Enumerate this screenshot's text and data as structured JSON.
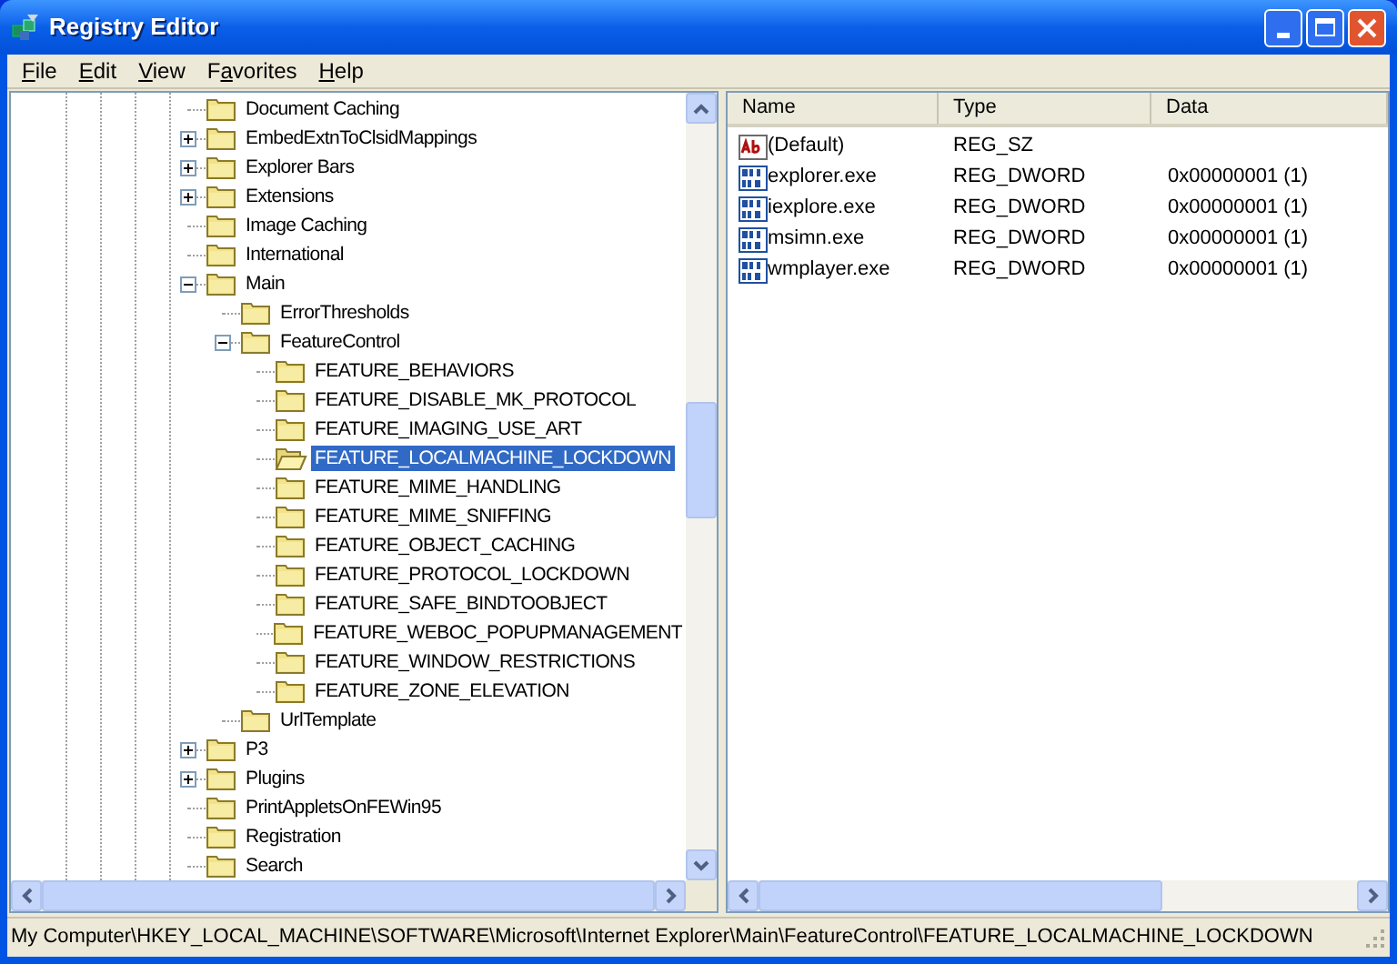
{
  "window": {
    "title": "Registry Editor"
  },
  "menu": [
    {
      "accel": "F",
      "after": "ile"
    },
    {
      "accel": "E",
      "after": "dit"
    },
    {
      "accel": "V",
      "after": "iew"
    },
    {
      "before": "F",
      "accel": "a",
      "after": "vorites"
    },
    {
      "accel": "H",
      "after": "elp"
    }
  ],
  "tree": [
    {
      "label": "Document Caching",
      "selected": false
    },
    {
      "label": "EmbedExtnToClsidMappings",
      "expanded": false,
      "selected": false
    },
    {
      "label": "Explorer Bars",
      "expanded": false,
      "selected": false
    },
    {
      "label": "Extensions",
      "expanded": false,
      "selected": false
    },
    {
      "label": "Image Caching",
      "selected": false
    },
    {
      "label": "International",
      "selected": false
    },
    {
      "label": "Main",
      "expanded": true,
      "selected": false,
      "children": [
        {
          "label": "ErrorThresholds",
          "selected": false
        },
        {
          "label": "FeatureControl",
          "expanded": true,
          "selected": false,
          "children": [
            {
              "label": "FEATURE_BEHAVIORS",
              "selected": false
            },
            {
              "label": "FEATURE_DISABLE_MK_PROTOCOL",
              "selected": false
            },
            {
              "label": "FEATURE_IMAGING_USE_ART",
              "selected": false
            },
            {
              "label": "FEATURE_LOCALMACHINE_LOCKDOWN",
              "selected": true
            },
            {
              "label": "FEATURE_MIME_HANDLING",
              "selected": false
            },
            {
              "label": "FEATURE_MIME_SNIFFING",
              "selected": false
            },
            {
              "label": "FEATURE_OBJECT_CACHING",
              "selected": false
            },
            {
              "label": "FEATURE_PROTOCOL_LOCKDOWN",
              "selected": false
            },
            {
              "label": "FEATURE_SAFE_BINDTOOBJECT",
              "selected": false
            },
            {
              "label": "FEATURE_WEBOC_POPUPMANAGEMENT",
              "selected": false
            },
            {
              "label": "FEATURE_WINDOW_RESTRICTIONS",
              "selected": false
            },
            {
              "label": "FEATURE_ZONE_ELEVATION",
              "selected": false
            }
          ]
        },
        {
          "label": "UrlTemplate",
          "selected": false
        }
      ]
    },
    {
      "label": "P3",
      "expanded": false,
      "selected": false
    },
    {
      "label": "Plugins",
      "expanded": false,
      "selected": false
    },
    {
      "label": "PrintAppletsOnFEWin95",
      "selected": false
    },
    {
      "label": "Registration",
      "selected": false
    },
    {
      "label": "Search",
      "selected": false
    }
  ],
  "values": {
    "columns": [
      "Name",
      "Type",
      "Data"
    ],
    "rows": [
      {
        "kind": "string",
        "name": "(Default)",
        "type": "REG_SZ"
      },
      {
        "kind": "dword",
        "name": "explorer.exe",
        "type": "REG_DWORD",
        "data": "0x00000001 (1)"
      },
      {
        "kind": "dword",
        "name": "iexplore.exe",
        "type": "REG_DWORD",
        "data": "0x00000001 (1)"
      },
      {
        "kind": "dword",
        "name": "msimn.exe",
        "type": "REG_DWORD",
        "data": "0x00000001 (1)"
      },
      {
        "kind": "dword",
        "name": "wmplayer.exe",
        "type": "REG_DWORD",
        "data": "0x00000001 (1)"
      }
    ]
  },
  "status_bar": "My Computer\\HKEY_LOCAL_MACHINE\\SOFTWARE\\Microsoft\\Internet Explorer\\Main\\FeatureControl\\FEATURE_LOCALMACHINE_LOCKDOWN"
}
